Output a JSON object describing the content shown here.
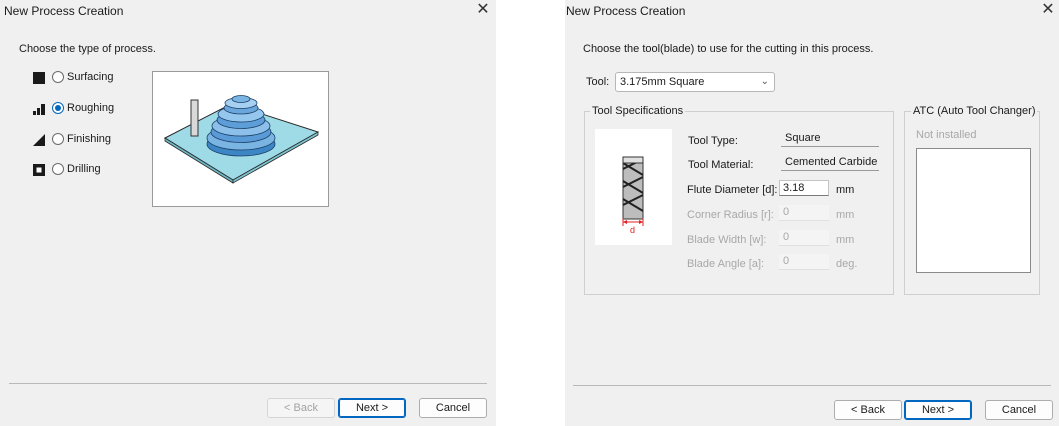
{
  "dialog1": {
    "title": "New Process Creation",
    "prompt": "Choose the type of process.",
    "process_types": [
      {
        "label": "Surfacing",
        "icon": "surfacing-icon",
        "checked": false
      },
      {
        "label": "Roughing",
        "icon": "roughing-icon",
        "checked": true
      },
      {
        "label": "Finishing",
        "icon": "finishing-icon",
        "checked": false
      },
      {
        "label": "Drilling",
        "icon": "drilling-icon",
        "checked": false
      }
    ],
    "buttons": {
      "back": "< Back",
      "next": "Next >",
      "cancel": "Cancel"
    }
  },
  "dialog2": {
    "title": "New Process Creation",
    "prompt": "Choose the tool(blade) to use for the cutting in this process.",
    "tool_label": "Tool:",
    "tool_value": "3.175mm Square",
    "specs_group": "Tool Specifications",
    "specs": {
      "tool_type_label": "Tool Type:",
      "tool_type_value": "Square",
      "tool_material_label": "Tool Material:",
      "tool_material_value": "Cemented Carbide",
      "flute_diameter_label": "Flute Diameter [d]:",
      "flute_diameter_value": "3.18",
      "flute_diameter_unit": "mm",
      "corner_radius_label": "Corner Radius [r]:",
      "corner_radius_value": "0",
      "corner_radius_unit": "mm",
      "blade_width_label": "Blade Width [w]:",
      "blade_width_value": "0",
      "blade_width_unit": "mm",
      "blade_angle_label": "Blade Angle [a]:",
      "blade_angle_value": "0",
      "blade_angle_unit": "deg.",
      "diagram_label": "d"
    },
    "atc_group": "ATC (Auto Tool Changer)",
    "atc_status": "Not installed",
    "buttons": {
      "back": "< Back",
      "next": "Next >",
      "cancel": "Cancel"
    }
  },
  "colors": {
    "accent": "#0067c0",
    "dialog_bg": "#f0f0f0",
    "preview_plate": "#9fdbe6"
  }
}
